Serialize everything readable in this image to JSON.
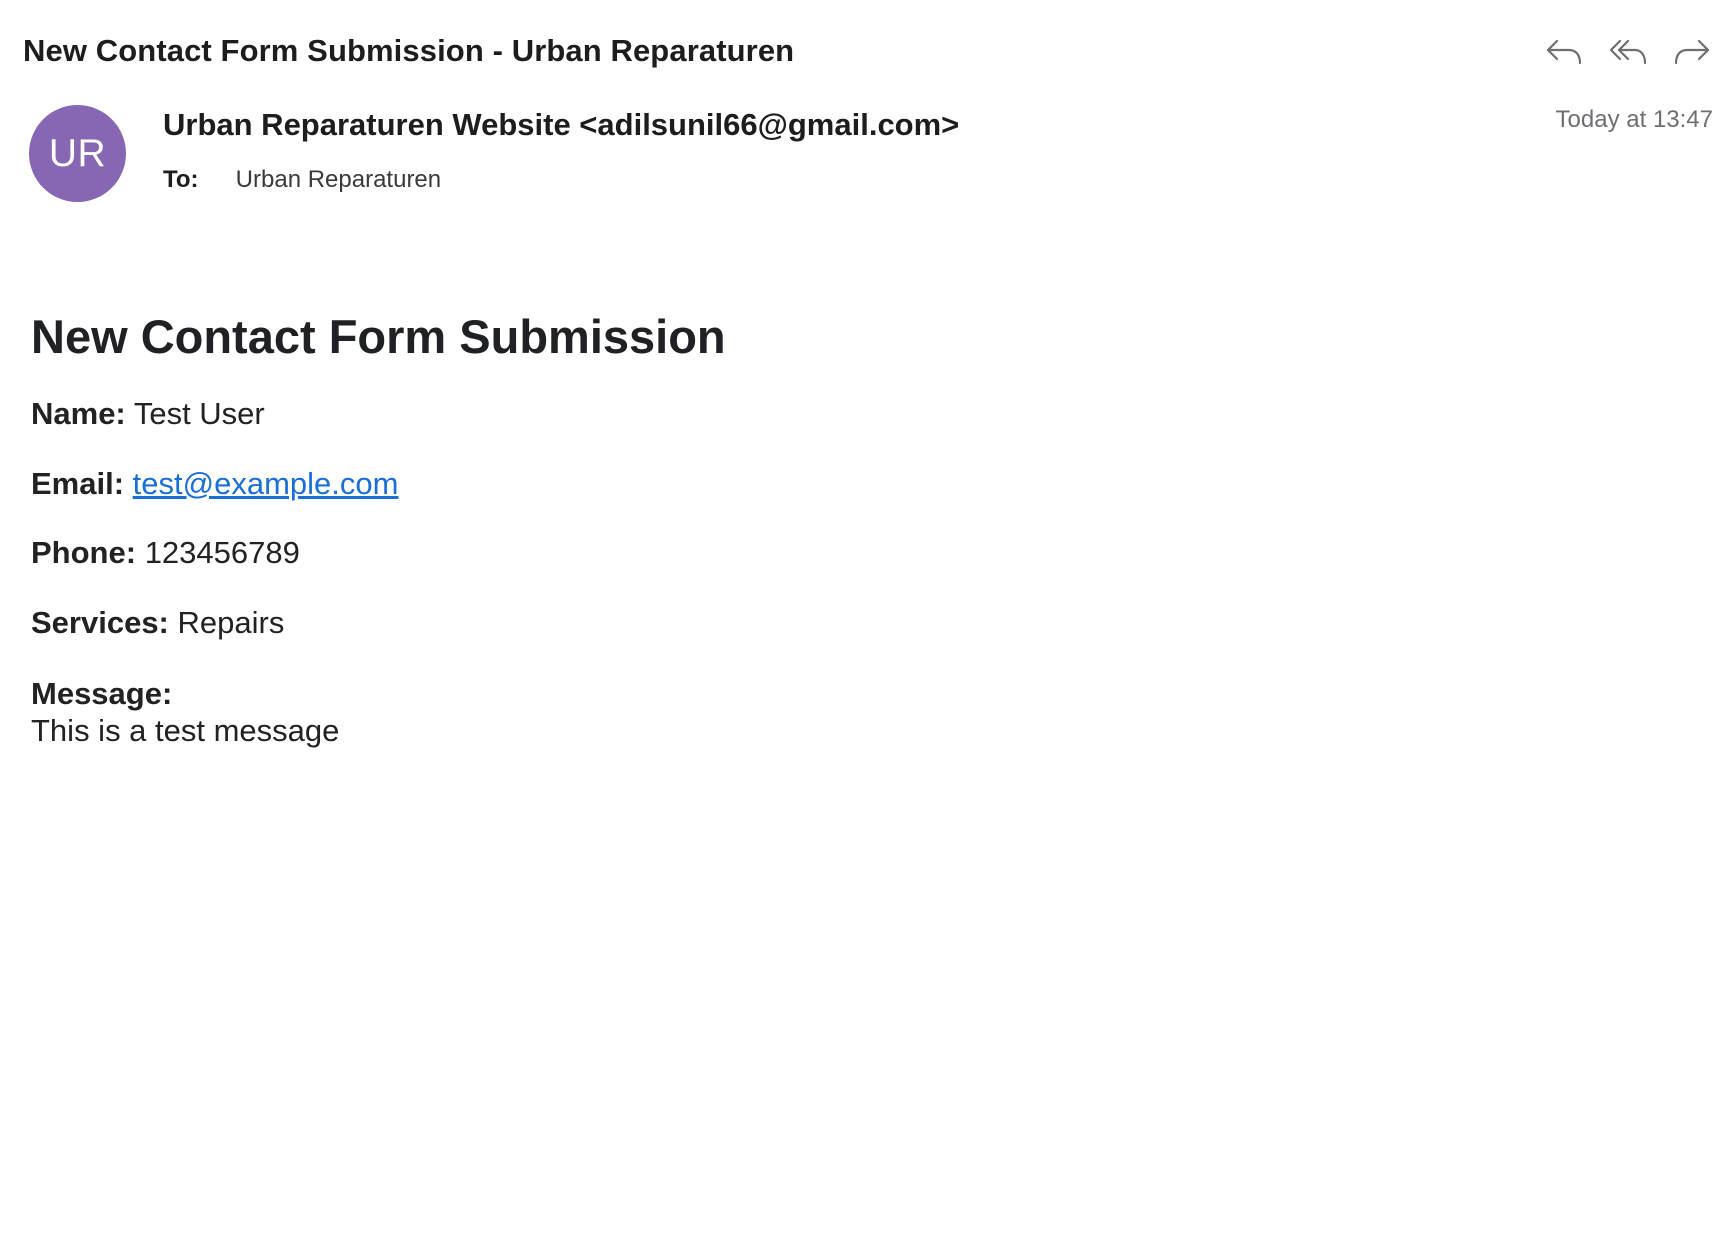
{
  "email": {
    "subject": "New Contact Form Submission - Urban Reparaturen",
    "avatar_initials": "UR",
    "avatar_color": "#8767b4",
    "sender": "Urban Reparaturen Website <adilsunil66@gmail.com>",
    "to_label": "To:",
    "to_value": "Urban Reparaturen",
    "timestamp": "Today at 13:47"
  },
  "actions": [
    {
      "name": "reply",
      "icon": "reply-icon"
    },
    {
      "name": "reply-all",
      "icon": "reply-all-icon"
    },
    {
      "name": "forward",
      "icon": "forward-icon"
    }
  ],
  "body": {
    "heading": "New Contact Form Submission",
    "name_label": "Name:",
    "name_value": "Test User",
    "email_label": "Email:",
    "email_value": "test@example.com",
    "phone_label": "Phone:",
    "phone_value": "123456789",
    "services_label": "Services:",
    "services_value": "Repairs",
    "message_label": "Message:",
    "message_value": "This is a test message"
  },
  "colors": {
    "link": "#1a6fd6",
    "icon": "#6e6e73"
  }
}
